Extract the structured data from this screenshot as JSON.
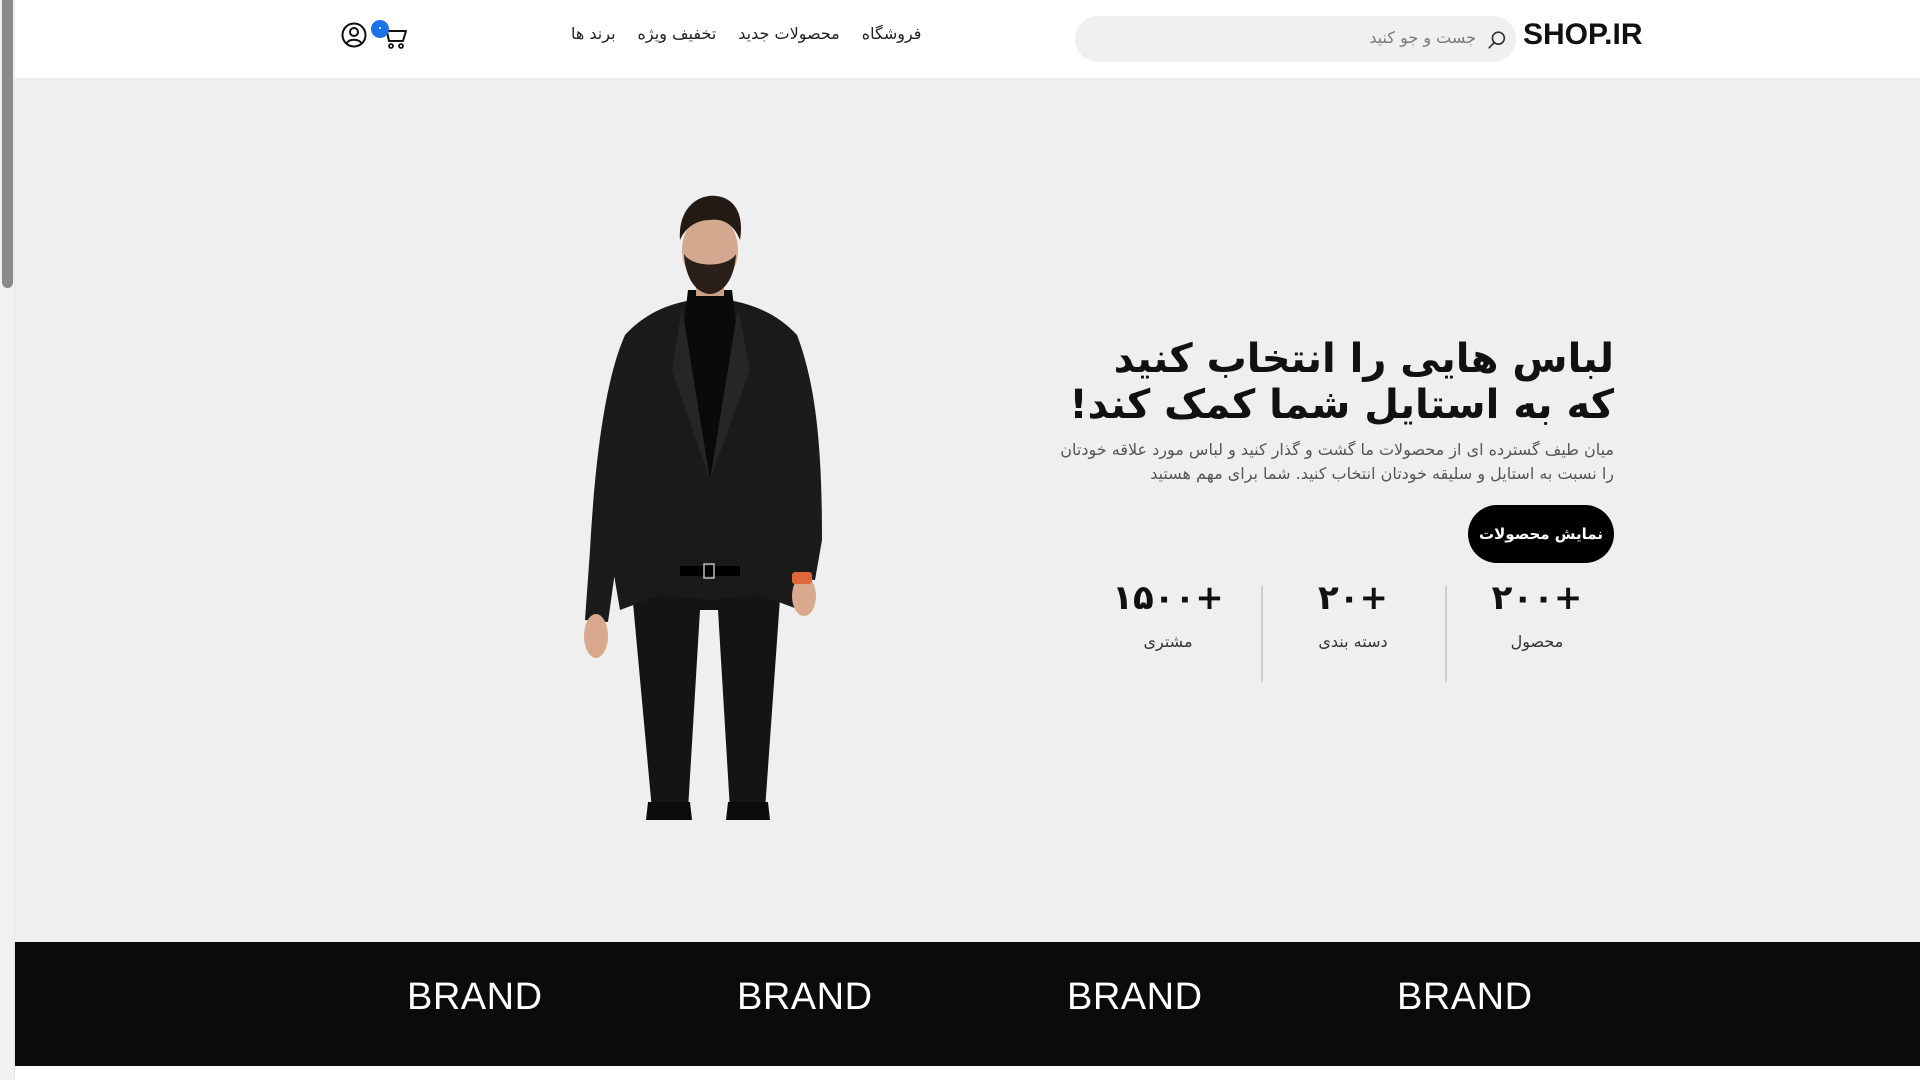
{
  "header": {
    "logo": "SHOP.IR",
    "search_placeholder": "جست و جو کنید",
    "nav": [
      "برند ها",
      "تخفیف ویژه",
      "محصولات جدید",
      "فروشگاه"
    ],
    "cart_count": "۰"
  },
  "hero": {
    "title": "لباس هایی را انتخاب کنید که به استایل شما کمک کند!",
    "description": "میان طیف گسترده ای از محصولات ما گشت و گذار کنید و لباس مورد علاقه خودتان را نسبت به استایل و سلیقه خودتان انتخاب کنید. شما برای مهم هستید",
    "button": "نمایش محصولات",
    "stats": [
      {
        "value": "+۲۰۰",
        "label": "محصول"
      },
      {
        "value": "+۲۰",
        "label": "دسته بندی"
      },
      {
        "value": "+۱۵۰۰",
        "label": "مشتری"
      }
    ]
  },
  "brands": [
    "BRAND",
    "BRAND",
    "BRAND",
    "BRAND"
  ],
  "colors": {
    "accent": "#000000",
    "badge": "#1a73e8",
    "hero_bg": "#efefef",
    "brand_band": "#0b0b0b"
  }
}
